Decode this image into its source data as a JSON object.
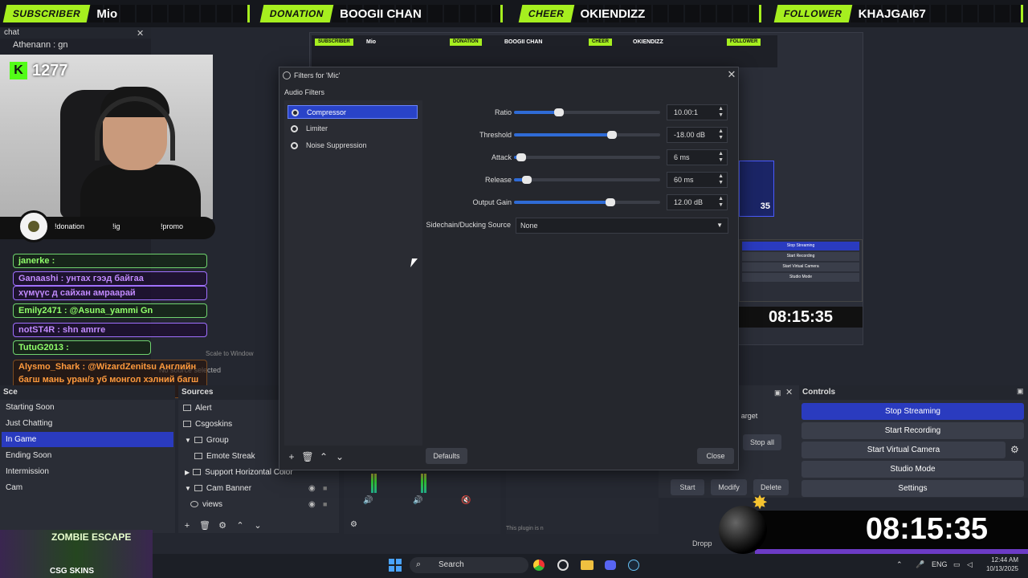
{
  "top_alerts": [
    {
      "tag": "SUBSCRIBER",
      "name": "Mio"
    },
    {
      "tag": "DONATION",
      "name": "BOOGII CHAN"
    },
    {
      "tag": "CHEER",
      "name": "OKIENDIZZ"
    },
    {
      "tag": "FOLLOWER",
      "name": "KHAJGAI67"
    }
  ],
  "chat": {
    "header": "chat",
    "first_line": "Athenann : gn",
    "kick_count": "1277",
    "commands": [
      "!donation",
      "!ig",
      "!promo"
    ],
    "messages": [
      {
        "user": "janerke",
        "text": "janerke :",
        "style": "green"
      },
      {
        "user": "Ganaashi",
        "text": "Ganaashi : унтах гээд байгаа",
        "style": "purple"
      },
      {
        "user": "",
        "text": "хүмүүс д сайхан амраарай",
        "style": "purple"
      },
      {
        "user": "Emily2471",
        "text": "Emily2471 : @Asuna_yammi Gn",
        "style": "green"
      },
      {
        "user": "notST4R",
        "text": "notST4R : shn amrre",
        "style": "purple"
      },
      {
        "user": "TutuG2013",
        "text": "TutuG2013 :",
        "style": "green"
      },
      {
        "user": "Alysmo_Shark",
        "text": "Alysmo_Shark : @WizardZenitsu Английн багш мань уран/з уб монгол хэлний багш болохлээр",
        "style": "orange"
      }
    ]
  },
  "scenes": {
    "header": "Sce",
    "items": [
      "Starting Soon",
      "Just Chatting",
      "In Game",
      "Ending Soon",
      "Intermission",
      "Cam"
    ],
    "selected": "In Game"
  },
  "sources": {
    "header": "Sources",
    "items": [
      "Alert",
      "Csgoskins",
      "Group",
      "Emote Streak",
      "Support Horizontal Color",
      "Cam Banner",
      "views"
    ]
  },
  "preview_info": {
    "no_source": "No source selected",
    "scale": "Scale to Window"
  },
  "controls": {
    "header": "Controls",
    "buttons": [
      "Stop Streaming",
      "Start Recording",
      "Start Virtual Camera",
      "Studio Mode",
      "Settings"
    ],
    "side_buttons": [
      "Start",
      "Modify",
      "Delete",
      "Stop all",
      "arget"
    ]
  },
  "mini_preview": {
    "clock": "08:15:35",
    "blue_label": "35"
  },
  "dialog": {
    "title": "Filters for 'Mic'",
    "section": "Audio Filters",
    "filters": [
      "Compressor",
      "Limiter",
      "Noise Suppression"
    ],
    "selected_filter": "Compressor",
    "params": [
      {
        "label": "Ratio",
        "value": "10.00:1",
        "fill": 0.31
      },
      {
        "label": "Threshold",
        "value": "-18.00 dB",
        "fill": 0.67
      },
      {
        "label": "Attack",
        "value": "6 ms",
        "fill": 0.05
      },
      {
        "label": "Release",
        "value": "60 ms",
        "fill": 0.09
      },
      {
        "label": "Output Gain",
        "value": "12.00 dB",
        "fill": 0.66
      }
    ],
    "sidechain_label": "Sidechain/Ducking Source",
    "sidechain_value": "None",
    "defaults_button": "Defaults",
    "close_button": "Close"
  },
  "bottom": {
    "clock": "08:15:35",
    "zombie_title": "ZOMBIE ESCAPE",
    "zombie_sponsor": "CSG SKINS",
    "dropped": "Dropp",
    "plugin_note": "This plugin is n"
  },
  "taskbar": {
    "search": "Search",
    "lang": "ENG",
    "time": "12:44 AM",
    "date": "10/13/2025"
  }
}
